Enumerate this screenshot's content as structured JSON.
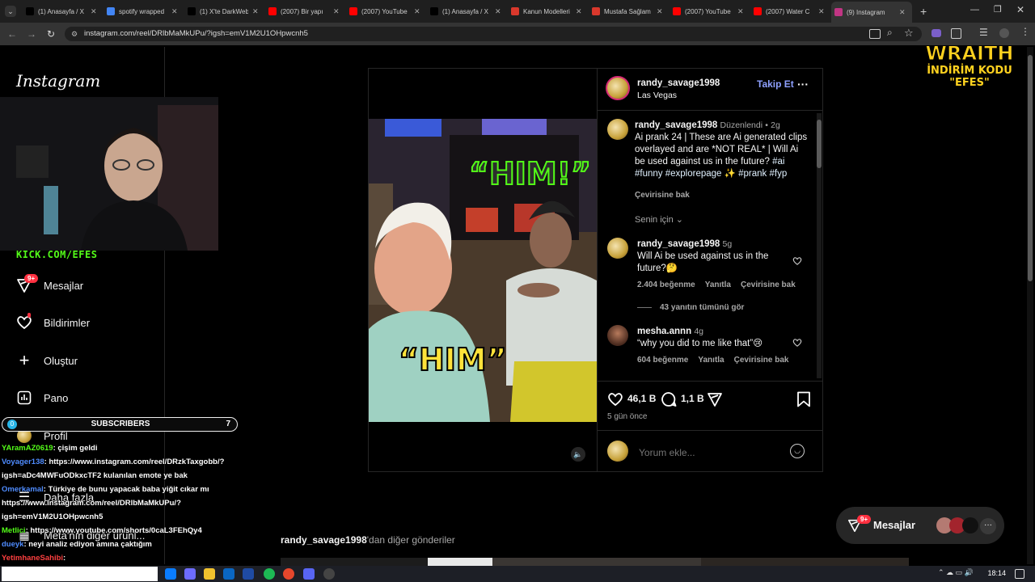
{
  "browser": {
    "tabs": [
      {
        "label": "(1) Anasayfa / X",
        "icon": "x-icon",
        "color": "#000000"
      },
      {
        "label": "spotify wrapped",
        "icon": "google-icon",
        "color": "#4285f4"
      },
      {
        "label": "(1) X'te DarkWeb",
        "icon": "x-icon",
        "color": "#000000"
      },
      {
        "label": "(2007) Bir yapı",
        "icon": "youtube-icon",
        "color": "#ff0000"
      },
      {
        "label": "(2007) YouTube",
        "icon": "youtube-icon",
        "color": "#ff0000"
      },
      {
        "label": "(1) Anasayfa / X",
        "icon": "x-icon",
        "color": "#000000"
      },
      {
        "label": "Kanun Modelleri",
        "icon": "site-icon",
        "color": "#d9382c"
      },
      {
        "label": "Mustafa Sağlam",
        "icon": "site-icon",
        "color": "#d9382c"
      },
      {
        "label": "(2007) YouTube",
        "icon": "youtube-icon",
        "color": "#ff0000"
      },
      {
        "label": "(2007) Water C",
        "icon": "youtube-icon",
        "color": "#ff0000"
      },
      {
        "label": "(9) Instagram",
        "icon": "instagram-icon",
        "color": "#c13584"
      }
    ],
    "url": "instagram.com/reel/DRlbMaMkUPu/?igsh=emV1M2U1OHpwcnh5"
  },
  "sidebar": {
    "logo": "Instagram",
    "items": [
      {
        "label": "Mesajlar",
        "icon": "messages-icon",
        "badge": "9+"
      },
      {
        "label": "Bildirimler",
        "icon": "heart-icon"
      },
      {
        "label": "Oluştur",
        "icon": "plus-icon"
      },
      {
        "label": "Pano",
        "icon": "dashboard-icon"
      },
      {
        "label": "Profil",
        "icon": "profile-icon"
      },
      {
        "label": "Daha fazla",
        "icon": "menu-icon"
      },
      {
        "label": "Meta'nın diğer ürünl...",
        "icon": "apps-icon"
      }
    ]
  },
  "stream_overlay": {
    "kick_url": "KICK.COM/EFES",
    "subs_count": "0",
    "subs_label": "SUBSCRIBERS",
    "subs_goal": "7",
    "sponsor_title": "WRAITH",
    "sponsor_line1": "İNDİRİM KODU",
    "sponsor_line2": "\"EFES\""
  },
  "chat": [
    {
      "user": "YAramAZ0619",
      "user_color": "#53fc18",
      "text": ": çişim geldi"
    },
    {
      "user": "Voyager138",
      "user_color": "#4f8cff",
      "text": ": https://www.instagram.com/reel/DRzkTaxgobb/?igsh=aDc4MWFuODkxcTF2 kulanılan emote ye bak"
    },
    {
      "user": "Omerkamal",
      "user_color": "#4f8cff",
      "text": ": Türkiye de bunu yapacak baba yiğit cıkar mı https://www.instagram.com/reel/DRlbMaMkUPu/?igsh=emV1M2U1OHpwcnh5"
    },
    {
      "user": "Metlici",
      "user_color": "#53fc18",
      "text": ": https://www.youtube.com/shorts/0caL3FEhQy4"
    },
    {
      "user": "dueyk",
      "user_color": "#4f8cff",
      "text": ": neyi analiz ediyon amına çaktığım"
    },
    {
      "user": "YetimhaneSahibi",
      "user_color": "#ff4040",
      "text": ":"
    }
  ],
  "post": {
    "username": "randy_savage1998",
    "location": "Las Vegas",
    "follow_label": "Takip Et",
    "caption_user": "randy_savage1998",
    "caption_edited": "Düzenlendi",
    "caption_age": "2g",
    "caption_text": "Ai prank 24 | These are Ai generated clips overlayed and are *NOT REAL* | Will Ai be used against us in the future?",
    "hashtags": "#ai #funny #explorepage ✨ #prank #fyp",
    "see_translation": "Çevirisine bak",
    "for_you": "Senin için",
    "video_caption_top": "“HIM!”",
    "video_caption_bottom": "“HIM”",
    "comments": [
      {
        "user": "randy_savage1998",
        "age": "5g",
        "text": "Will Ai be used against us in the future?🤔",
        "likes": "2.404 beğenme",
        "reply": "Yanıtla",
        "translate": "Çevirisine bak",
        "view_replies": "43 yanıtın tümünü gör"
      },
      {
        "user": "mesha.annn",
        "age": "4g",
        "text": "“why you did to me like that”😢",
        "likes": "604 beğenme",
        "reply": "Yanıtla",
        "translate": "Çevirisine bak"
      }
    ],
    "likes_count": "46,1 B",
    "comments_count": "1,1 B",
    "posted_ago": "5 gün önce",
    "comment_placeholder": "Yorum ekle..."
  },
  "more_posts": {
    "username": "randy_savage1998",
    "suffix": "'dan diğer gönderiler"
  },
  "floating_messages": {
    "label": "Mesajlar",
    "badge": "9+"
  },
  "taskbar": {
    "time": "18:14"
  }
}
